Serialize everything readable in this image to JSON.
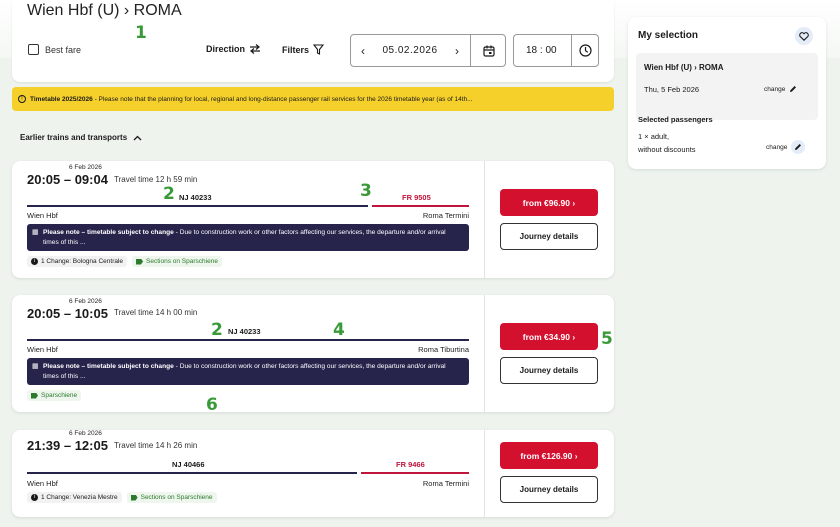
{
  "header": {
    "route": "Wien Hbf (U) › ROMA",
    "best_fare_label": "Best fare",
    "direction_label": "Direction",
    "filters_label": "Filters",
    "date": "05.02.2026",
    "time": "18 : 00"
  },
  "banner": {
    "title": "Timetable 2025/2026",
    "text": " - Please note that the planning for local, regional and long-distance passenger rail services for the 2026 timetable year (as of 14th..."
  },
  "earlier_label": "Earlier trains and transports",
  "connections": [
    {
      "date": "6 Feb 2026",
      "times": "20:05 – 09:04",
      "travel": "Travel time 12 h 59 min",
      "train1": "NJ 40233",
      "train2": "FR 9505",
      "from": "Wien Hbf",
      "to": "Roma Termini",
      "notice_title": "Please note – timetable subject to change",
      "notice_text": " - Due to construction work or other factors affecting our services, the departure and/or arrival times of this ...",
      "tag1": "1 Change: Bologna Centrale",
      "tag2": "Sections on Sparschiene",
      "price": "from €96.90",
      "details": "Journey details"
    },
    {
      "date": "6 Feb 2026",
      "times": "20:05 – 10:05",
      "travel": "Travel time 14 h 00 min",
      "train1": "NJ 40233",
      "from": "Wien Hbf",
      "to": "Roma Tiburtina",
      "notice_title": "Please note – timetable subject to change",
      "notice_text": " - Due to construction work or other factors affecting our services, the departure and/or arrival times of this ...",
      "tag1": "Sparschiene",
      "price": "from €34.90",
      "details": "Journey details"
    },
    {
      "date": "6 Feb 2026",
      "times": "21:39 – 12:05",
      "travel": "Travel time 14 h 26 min",
      "train1": "NJ 40466",
      "train2": "FR 9466",
      "from": "Wien Hbf",
      "to": "Roma Termini",
      "tag1": "1 Change: Venezia Mestre",
      "tag2": "Sections on Sparschiene",
      "price": "from €126.90",
      "details": "Journey details"
    }
  ],
  "sidebar": {
    "title": "My selection",
    "route": "Wien Hbf (U) › ROMA",
    "date": "Thu, 5 Feb 2026",
    "change_label": "change",
    "passengers_title": "Selected passengers",
    "passengers_line1": "1 × adult,",
    "passengers_line2": "without discounts"
  },
  "annotations": [
    "1",
    "2",
    "3",
    "2",
    "4",
    "5",
    "6"
  ],
  "colors": {
    "accent_red": "#d3102e",
    "notice_bg": "#27244c",
    "banner_yellow": "#f5cf2a",
    "annotation_green": "#3a9a3a"
  }
}
